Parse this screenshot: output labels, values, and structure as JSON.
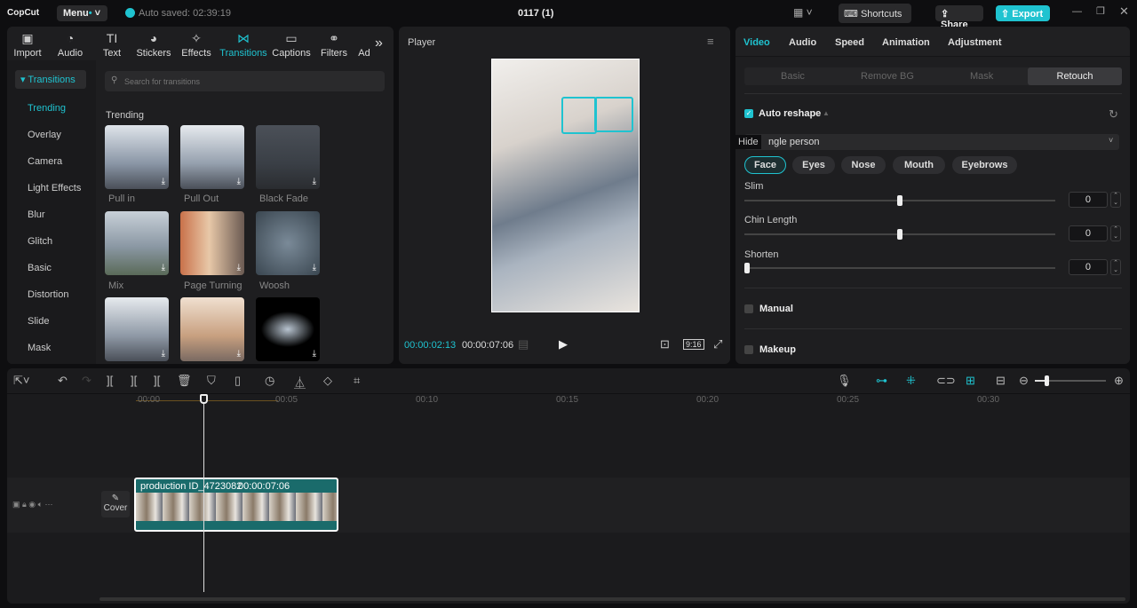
{
  "app": {
    "logo": "CopCut",
    "menu": "Menu",
    "autosave": "Auto saved: 02:39:19",
    "project_title": "0117 (1)",
    "shortcuts": "Shortcuts",
    "share": "Share",
    "export": "Export"
  },
  "toolbar": [
    {
      "label": "Import",
      "icon": "▣"
    },
    {
      "label": "Audio",
      "icon": "◔"
    },
    {
      "label": "Text",
      "icon": "TI"
    },
    {
      "label": "Stickers",
      "icon": "◕"
    },
    {
      "label": "Effects",
      "icon": "✧"
    },
    {
      "label": "Transitions",
      "icon": "⋈"
    },
    {
      "label": "Captions",
      "icon": "▭"
    },
    {
      "label": "Filters",
      "icon": "⚭"
    },
    {
      "label": "Ad",
      "icon": ""
    }
  ],
  "sidebar": {
    "header": "Transitions",
    "items": [
      "Trending",
      "Overlay",
      "Camera",
      "Light Effects",
      "Blur",
      "Glitch",
      "Basic",
      "Distortion",
      "Slide",
      "Mask"
    ]
  },
  "search": {
    "placeholder": "Search for transitions"
  },
  "section_title": "Trending",
  "transitions": [
    "Pull in",
    "Pull Out",
    "Black Fade",
    "Mix",
    "Page Turning",
    "Woosh",
    "",
    "",
    ""
  ],
  "player": {
    "title": "Player",
    "current": "00:00:02:13",
    "total": "00:00:07:06",
    "ratio": "9:16"
  },
  "inspector": {
    "tabs": [
      "Video",
      "Audio",
      "Speed",
      "Animation",
      "Adjustment"
    ],
    "subtabs": [
      "Basic",
      "Remove BG",
      "Mask",
      "Retouch"
    ],
    "auto_reshape": "Auto reshape",
    "tooltip": "Hide",
    "dropdown": "ngle person",
    "chips": [
      "Face",
      "Eyes",
      "Nose",
      "Mouth",
      "Eyebrows"
    ],
    "sliders": [
      {
        "label": "Slim",
        "value": "0",
        "pos": 0.5
      },
      {
        "label": "Chin Length",
        "value": "0",
        "pos": 0.5
      },
      {
        "label": "Shorten",
        "value": "0",
        "pos": 0
      }
    ],
    "manual": "Manual",
    "makeup": "Makeup"
  },
  "timeline": {
    "ruler": [
      "00:00",
      "00:05",
      "00:10",
      "00:15",
      "00:20",
      "00:25",
      "00:30"
    ],
    "clip_name": "production ID_4723082",
    "clip_duration": "00:00:07:06",
    "cover": "Cover"
  },
  "colors": {
    "accent": "#1fc3d0",
    "clip": "#1a6b6b"
  }
}
